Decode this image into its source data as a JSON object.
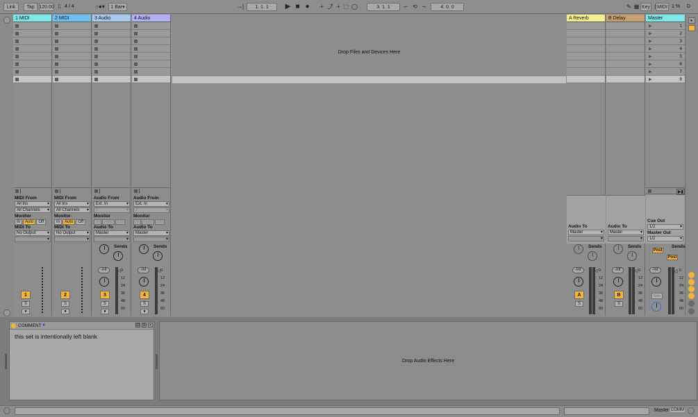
{
  "toolbar": {
    "link": "Link",
    "tap": "Tap",
    "tempo": "120.00",
    "sig_num": "4",
    "sig_den": "4",
    "quant": "1 Bar",
    "arr_pos": "1.   1.   1",
    "loop_start": "3.   1.   1",
    "loop_len": "4.   0.   0",
    "key": "Key",
    "midi": "MIDI",
    "cpu": "1 %",
    "d": "D"
  },
  "tracks": [
    {
      "name": "1 MIDI",
      "color": "#7ee8e8",
      "type": "midi",
      "num": "1",
      "from_label": "MIDI From",
      "from": "All Ins",
      "chan": "All Channels",
      "monitor_label": "Monitor",
      "mon": [
        "In",
        "Auto",
        "Off"
      ],
      "to_label": "MIDI To",
      "to": "No Output"
    },
    {
      "name": "2 MIDI",
      "color": "#6cc1f0",
      "type": "midi",
      "num": "2",
      "from_label": "MIDI From",
      "from": "All Ins",
      "chan": "All Channels",
      "monitor_label": "Monitor",
      "mon": [
        "In",
        "Auto",
        "Off"
      ],
      "to_label": "MIDI To",
      "to": "No Output"
    },
    {
      "name": "3 Audio",
      "color": "#a8c8f0",
      "type": "audio",
      "num": "3",
      "from_label": "Audio From",
      "from": "Ext. In",
      "chan": "1",
      "monitor_label": "Monitor",
      "mon": [
        "In",
        "Auto",
        "Off"
      ],
      "to_label": "Audio To",
      "to": "Master",
      "sends": "Sends",
      "vol": "-Inf"
    },
    {
      "name": "4 Audio",
      "color": "#b0b0f4",
      "type": "audio",
      "num": "4",
      "from_label": "Audio From",
      "from": "Ext. In",
      "chan": "2",
      "monitor_label": "Monitor",
      "mon": [
        "In",
        "Auto",
        "Off"
      ],
      "to_label": "Audio To",
      "to": "Master",
      "sends": "Sends",
      "vol": "-Inf"
    }
  ],
  "returns": [
    {
      "name": "A Reverb",
      "color": "#f4f092",
      "letter": "A",
      "to_label": "Audio To",
      "to": "Master",
      "sends": "Sends",
      "vol": "-Inf"
    },
    {
      "name": "B Delay",
      "color": "#c8a070",
      "letter": "B",
      "to_label": "Audio To",
      "to": "Master",
      "sends": "Sends",
      "vol": "-Inf"
    }
  ],
  "master": {
    "name": "Master",
    "color": "#7ee8e8",
    "scenes": [
      "1",
      "2",
      "3",
      "4",
      "5",
      "6",
      "7",
      "8"
    ],
    "cue_label": "Cue Out",
    "cue": "1/2",
    "out_label": "Master Out",
    "out": "1/2",
    "sends": "Sends",
    "post": "Post",
    "vol": "-Inf",
    "solo": "Solo"
  },
  "meter_scale": [
    "0",
    "12",
    "24",
    "36",
    "48",
    "60"
  ],
  "drop_files": "Drop Files and Devices Here",
  "drop_fx": "Drop Audio Effects Here",
  "comment": {
    "title": "COMMENT",
    "text": "this set is intentionally left blank"
  },
  "status": {
    "master": "Master",
    "comm": "COMM"
  }
}
